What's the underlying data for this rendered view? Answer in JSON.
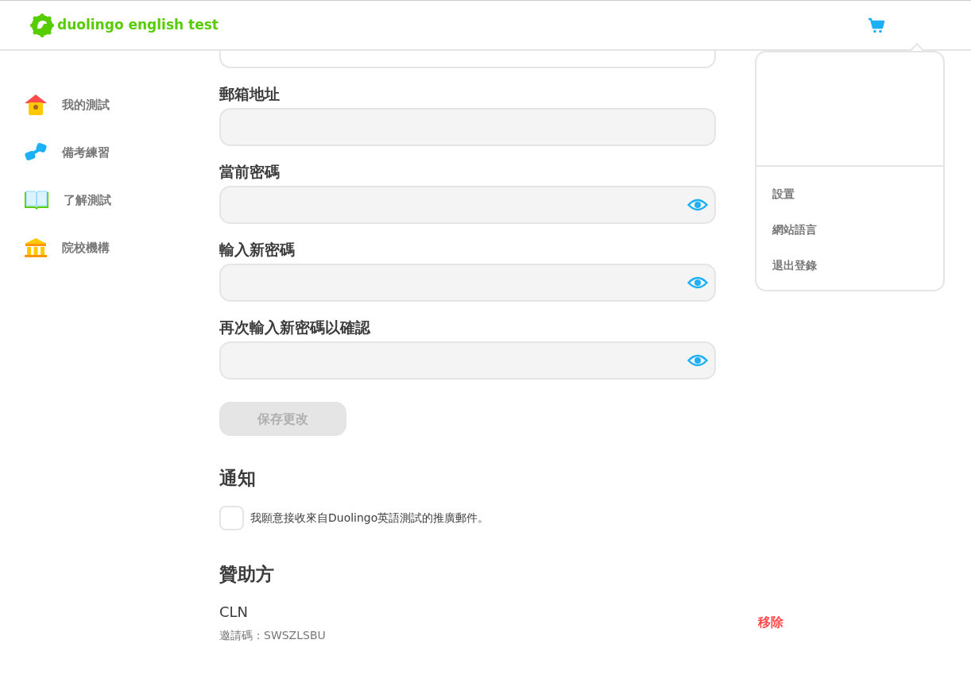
{
  "header": {
    "logo": "duolingo english test"
  },
  "sidebar": {
    "items": [
      {
        "label": "我的測試",
        "selected": false
      },
      {
        "label": "備考練習",
        "selected": false
      },
      {
        "label": "了解測試",
        "selected": false
      },
      {
        "label": "院校機構",
        "selected": false
      }
    ]
  },
  "form": {
    "fields": [
      {
        "kind": "text"
      },
      {
        "kind": "text",
        "label": "郵箱地址"
      },
      {
        "kind": "password",
        "label": "當前密碼"
      },
      {
        "kind": "password",
        "label": "輸入新密碼"
      },
      {
        "kind": "password",
        "label": "再次輸入新密碼以確認"
      }
    ],
    "save_button": {
      "label": "保存更改",
      "disabled": true
    }
  },
  "notifications": {
    "heading": "通知",
    "option": {
      "label": "我願意接收來自Duolingo英語測試的推廣郵件。",
      "checked": false
    }
  },
  "sponsors": {
    "heading": "贊助方",
    "items": [
      {
        "name": "CLN",
        "code": "邀請碼：SWSZLSBU",
        "action": "移除"
      }
    ]
  },
  "account_menu": {
    "items": [
      "設置",
      "網站語言",
      "退出登錄"
    ]
  }
}
